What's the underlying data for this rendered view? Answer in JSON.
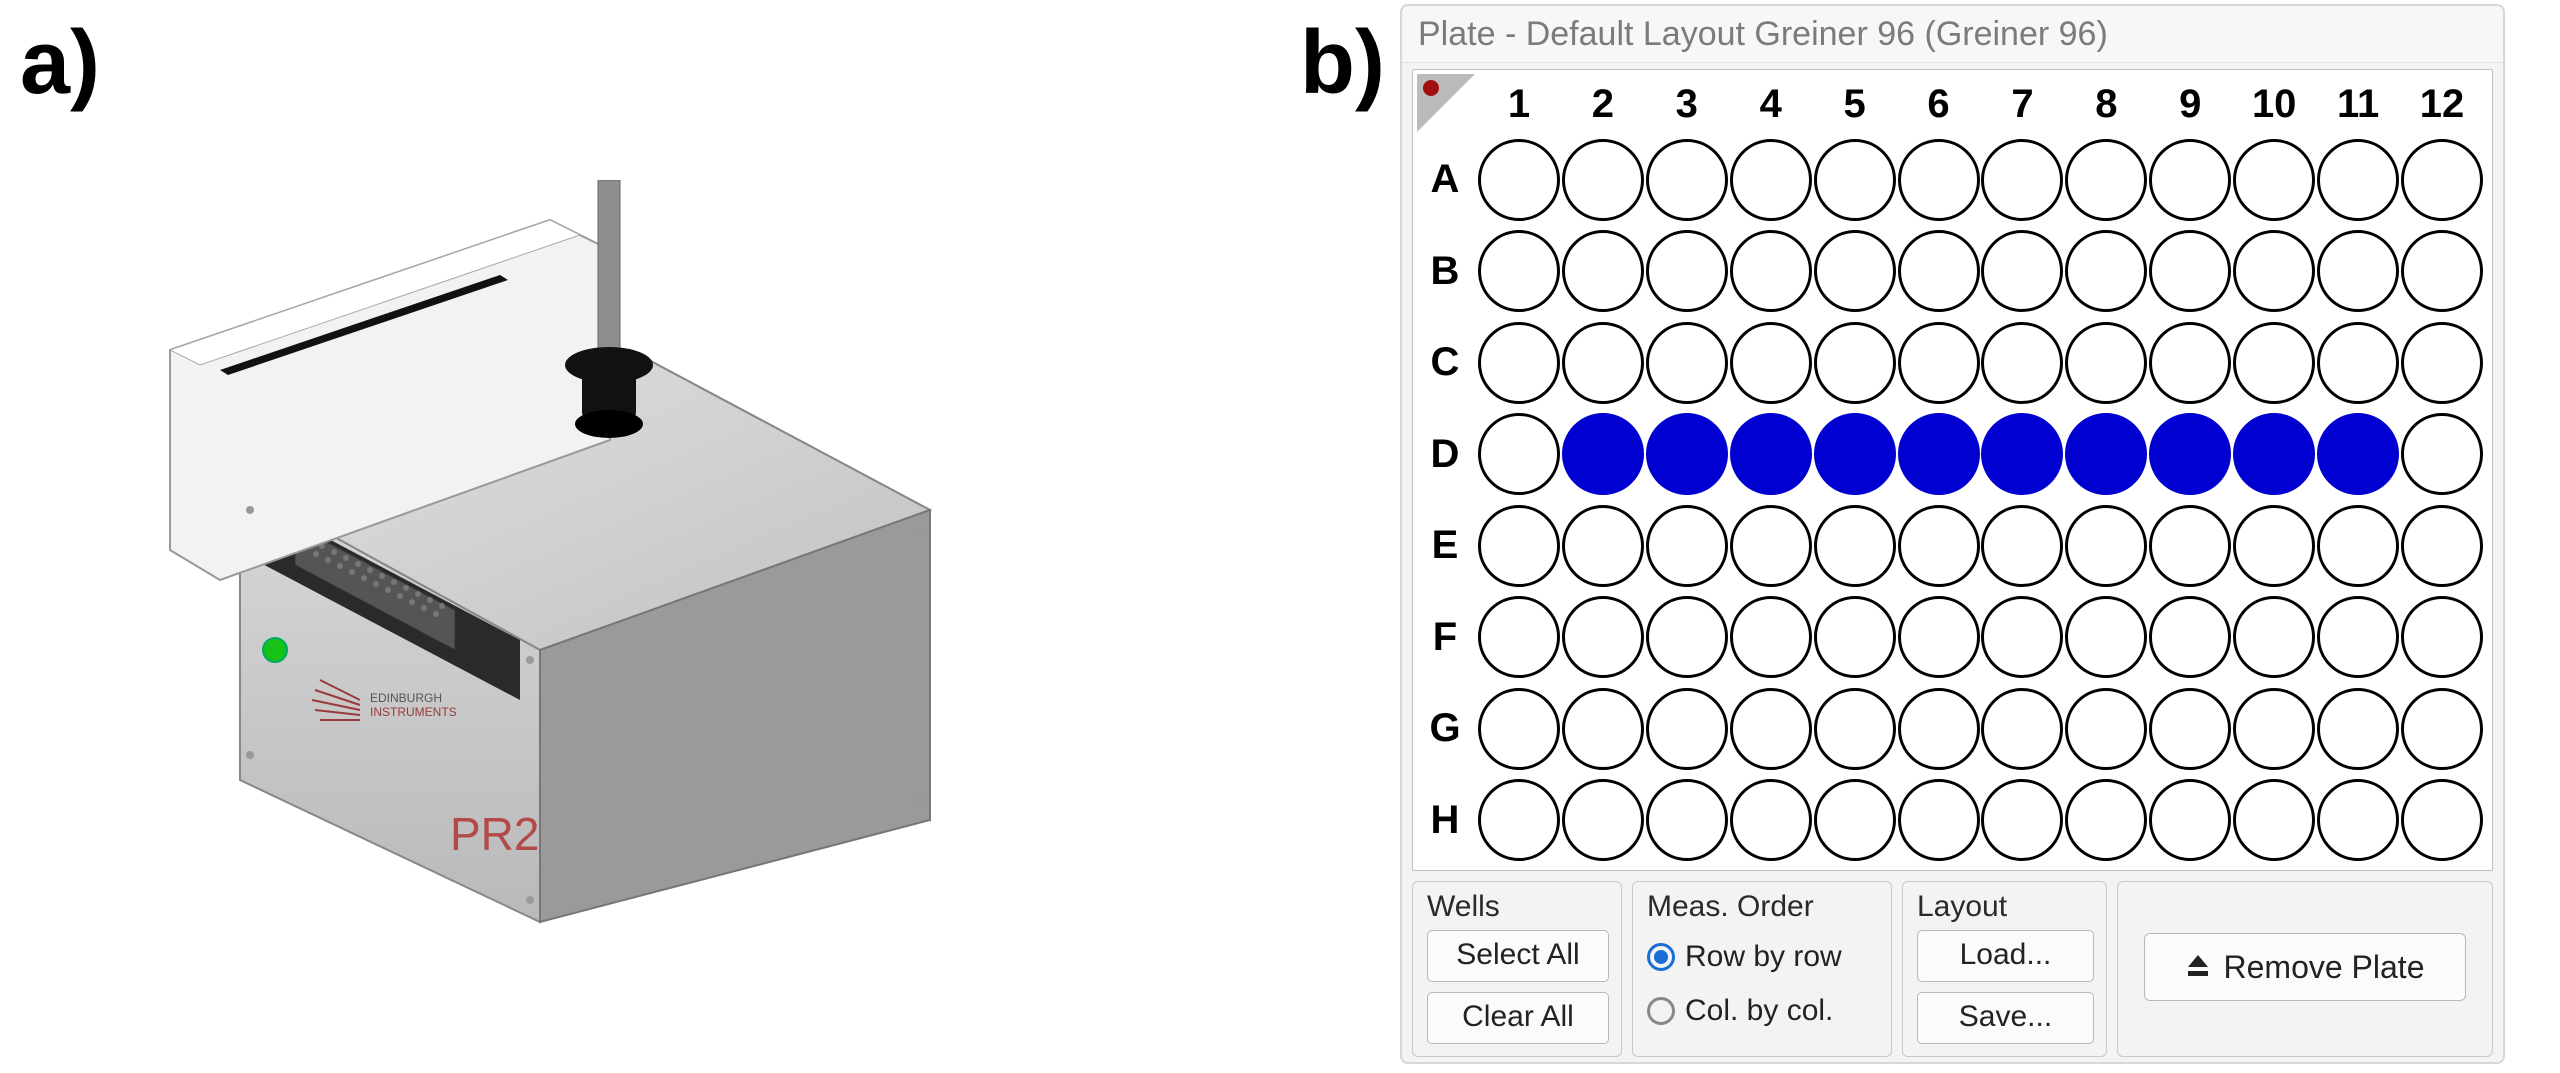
{
  "labels": {
    "a": "a)",
    "b": "b)"
  },
  "instrument": {
    "model": "PR2",
    "brand_line1": "EDINBURGH",
    "brand_line2": "INSTRUMENTS"
  },
  "dialog": {
    "title": "Plate - Default Layout Greiner 96 (Greiner 96)",
    "columns": [
      "1",
      "2",
      "3",
      "4",
      "5",
      "6",
      "7",
      "8",
      "9",
      "10",
      "11",
      "12"
    ],
    "rows": [
      "A",
      "B",
      "C",
      "D",
      "E",
      "F",
      "G",
      "H"
    ],
    "selected_wells": [
      "D2",
      "D3",
      "D4",
      "D5",
      "D6",
      "D7",
      "D8",
      "D9",
      "D10",
      "D11"
    ],
    "groups": {
      "wells": {
        "title": "Wells",
        "select_all": "Select All",
        "clear_all": "Clear All"
      },
      "order": {
        "title": "Meas. Order",
        "row_by_row": "Row by row",
        "col_by_col": "Col. by col.",
        "checked": "row"
      },
      "layout": {
        "title": "Layout",
        "load": "Load...",
        "save": "Save..."
      },
      "remove": {
        "label": "Remove Plate"
      }
    }
  }
}
